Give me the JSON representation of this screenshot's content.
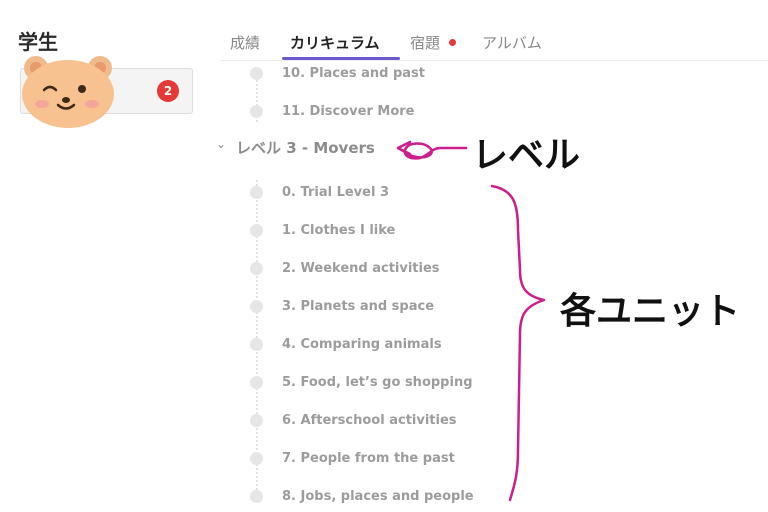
{
  "student": {
    "title": "学生",
    "badge_count": "2"
  },
  "tabs": [
    {
      "label": "成績"
    },
    {
      "label": "カリキュラム"
    },
    {
      "label": "宿題"
    },
    {
      "label": "アルバム"
    }
  ],
  "curriculum": {
    "prev_items": [
      {
        "label": "10. Places and past"
      },
      {
        "label": "11. Discover More"
      }
    ],
    "level": {
      "label": "レベル 3 - Movers",
      "units": [
        {
          "label": "0. Trial Level 3"
        },
        {
          "label": "1. Clothes I like"
        },
        {
          "label": "2. Weekend activities"
        },
        {
          "label": "3. Planets and space"
        },
        {
          "label": "4. Comparing animals"
        },
        {
          "label": "5. Food, let’s go shopping"
        },
        {
          "label": "6. Afterschool activities"
        },
        {
          "label": "7. People from the past"
        },
        {
          "label": "8. Jobs, places and people"
        }
      ]
    }
  },
  "annotations": {
    "level": "レベル",
    "units": "各ユニット",
    "color": "#cc1e8c"
  },
  "colors": {
    "accent": "#6a5acd",
    "badge": "#e53935"
  }
}
